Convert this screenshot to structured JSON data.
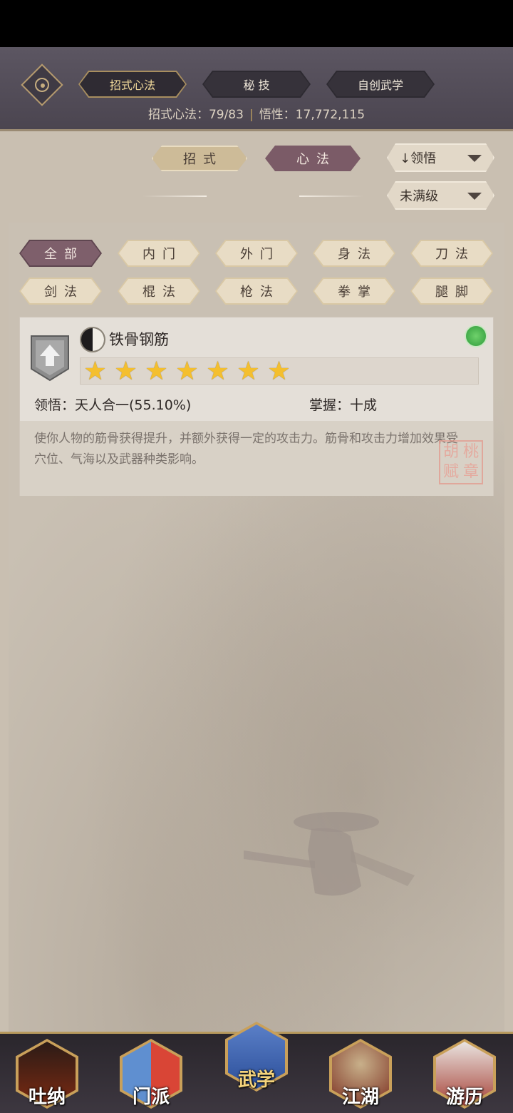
{
  "header": {
    "tabs": [
      {
        "label": "招式心法",
        "active": true
      },
      {
        "label": "秘 技",
        "active": false
      },
      {
        "label": "自创武学",
        "active": false
      }
    ],
    "stats": {
      "count_label": "招式心法：79/83",
      "separator": "|",
      "insight_label": "悟性：17,772,115"
    }
  },
  "sub_tabs": [
    {
      "label": "招式",
      "active": false
    },
    {
      "label": "心法",
      "active": true
    }
  ],
  "filters": {
    "sort_label": "↓领悟",
    "level_label": "未满级"
  },
  "categories": [
    {
      "label": "全部",
      "active": true
    },
    {
      "label": "内门"
    },
    {
      "label": "外门"
    },
    {
      "label": "身法"
    },
    {
      "label": "刀法"
    },
    {
      "label": "剑法"
    },
    {
      "label": "棍法"
    },
    {
      "label": "枪法"
    },
    {
      "label": "拳掌"
    },
    {
      "label": "腿脚"
    }
  ],
  "skill_card": {
    "name": "铁骨钢筋",
    "stars": 7,
    "comprehension": "领悟：天人合一(55.10%)",
    "mastery": "掌握：十成",
    "description": "使你人物的筋骨获得提升，并额外获得一定的攻击力。筋骨和攻击力增加效果受穴位、气海以及武器种类影响。",
    "seal_text": "胡桃赋章",
    "colors": {
      "star": "#f4bf2e",
      "refresh": "#2f9b3b"
    }
  },
  "bottom_nav": [
    {
      "label": "吐纳",
      "icon": "monk-icon"
    },
    {
      "label": "门派",
      "icon": "sect-flag-icon"
    },
    {
      "label": "武学",
      "icon": "scroll-book-icon",
      "active": true
    },
    {
      "label": "江湖",
      "icon": "straw-hat-icon"
    },
    {
      "label": "游历",
      "icon": "horse-icon"
    }
  ]
}
